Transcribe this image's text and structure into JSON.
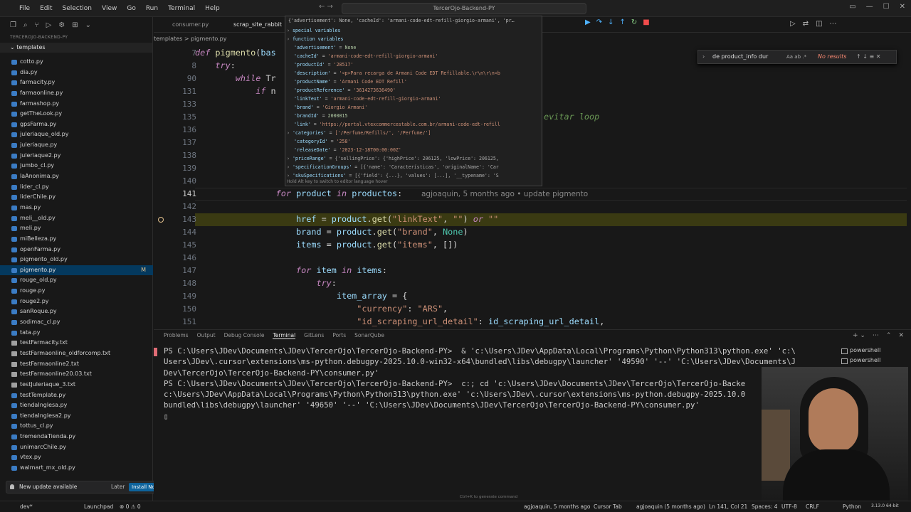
{
  "titlebar": {
    "menu": [
      "File",
      "Edit",
      "Selection",
      "View",
      "Go",
      "Run",
      "Terminal",
      "Help"
    ],
    "search": "TercerOjo-Backend-PY"
  },
  "sidebar": {
    "project": "TERCEROJO-BACKEND-PY",
    "folder": "templates",
    "files": [
      {
        "name": "cotto.py",
        "type": "py"
      },
      {
        "name": "dia.py",
        "type": "py"
      },
      {
        "name": "farmacity.py",
        "type": "py"
      },
      {
        "name": "farmaonline.py",
        "type": "py"
      },
      {
        "name": "farmashop.py",
        "type": "py"
      },
      {
        "name": "getTheLook.py",
        "type": "py"
      },
      {
        "name": "gpsFarma.py",
        "type": "py"
      },
      {
        "name": "juleriaque_old.py",
        "type": "py"
      },
      {
        "name": "juleriaque.py",
        "type": "py"
      },
      {
        "name": "juleriaque2.py",
        "type": "py"
      },
      {
        "name": "jumbo_cl.py",
        "type": "py"
      },
      {
        "name": "laAnonima.py",
        "type": "py"
      },
      {
        "name": "lider_cl.py",
        "type": "py"
      },
      {
        "name": "liderChile.py",
        "type": "py"
      },
      {
        "name": "mas.py",
        "type": "py"
      },
      {
        "name": "meli__old.py",
        "type": "py"
      },
      {
        "name": "meli.py",
        "type": "py"
      },
      {
        "name": "miBelleza.py",
        "type": "py"
      },
      {
        "name": "openFarma.py",
        "type": "py"
      },
      {
        "name": "pigmento_old.py",
        "type": "py"
      },
      {
        "name": "pigmento.py",
        "type": "py",
        "active": true,
        "mark": "M"
      },
      {
        "name": "rouge_old.py",
        "type": "py"
      },
      {
        "name": "rouge.py",
        "type": "py"
      },
      {
        "name": "rouge2.py",
        "type": "py"
      },
      {
        "name": "sanRoque.py",
        "type": "py"
      },
      {
        "name": "sodimac_cl.py",
        "type": "py"
      },
      {
        "name": "tata.py",
        "type": "py"
      },
      {
        "name": "testFarmacity.txt",
        "type": "txt"
      },
      {
        "name": "testFarmaonline_oldforcomp.txt",
        "type": "txt"
      },
      {
        "name": "testFarmaonline2.txt",
        "type": "txt"
      },
      {
        "name": "testFarmaonline20.03.txt",
        "type": "txt"
      },
      {
        "name": "testJuleriaque_3.txt",
        "type": "txt"
      },
      {
        "name": "testTemplate.py",
        "type": "py"
      },
      {
        "name": "tiendaInglesa.py",
        "type": "py"
      },
      {
        "name": "tiendaInglesa2.py",
        "type": "py"
      },
      {
        "name": "tottus_cl.py",
        "type": "py"
      },
      {
        "name": "tremendaTienda.py",
        "type": "py"
      },
      {
        "name": "unimarcChile.py",
        "type": "py"
      },
      {
        "name": "vtex.py",
        "type": "py"
      },
      {
        "name": "walmart_mx_old.py",
        "type": "py"
      }
    ],
    "toast": {
      "text": "New update available",
      "later": "Later",
      "install": "Install Now"
    }
  },
  "editor": {
    "tabs": [
      "consumer.py",
      "scrap_site_rabbit"
    ],
    "breadcrumb": "templates  >  pigmento.py",
    "lines": [
      {
        "n": "7",
        "html": "<span class='kw'>def</span> <span class='fn'>pigmento</span>(<span class='var'>bas</span>"
      },
      {
        "n": "8",
        "html": "    <span class='kw'>try</span>:"
      },
      {
        "n": "90",
        "html": "        <span class='kw'>while</span> Tr"
      },
      {
        "n": "131",
        "html": "            <span class='kw'>if</span> n"
      },
      {
        "n": "133",
        "html": ""
      },
      {
        "n": "135",
        "html": "                                                   <span class='cmt'>a, avanzamos para evitar loop</span>"
      },
      {
        "n": "136",
        "html": ""
      },
      {
        "n": "137",
        "html": ""
      },
      {
        "n": "138",
        "html": ""
      },
      {
        "n": "139",
        "html": ""
      },
      {
        "n": "140",
        "html": ""
      },
      {
        "n": "141",
        "html": "                <span class='kw'>for</span> <span class='var'>product</span> <span class='kw'>in</span> <span class='var'>productos</span>:"
      },
      {
        "n": "142",
        "html": ""
      },
      {
        "n": "143",
        "html": "                    <span class='var'>href</span> = <span class='var'>product</span>.<span class='fn'>get</span>(<span class='str'>\"linkText\"</span>, <span class='str'>\"\"</span>) <span class='kw'>or</span> <span class='str'>\"\"</span>"
      },
      {
        "n": "144",
        "html": "                    <span class='var'>brand</span> = <span class='var'>product</span>.<span class='fn'>get</span>(<span class='str'>\"brand\"</span>, <span class='cls'>None</span>)"
      },
      {
        "n": "145",
        "html": "                    <span class='var'>items</span> = <span class='var'>product</span>.<span class='fn'>get</span>(<span class='str'>\"items\"</span>, [])"
      },
      {
        "n": "146",
        "html": ""
      },
      {
        "n": "147",
        "html": "                    <span class='kw'>for</span> <span class='var'>item</span> <span class='kw'>in</span> <span class='var'>items</span>:"
      },
      {
        "n": "148",
        "html": "                        <span class='kw'>try</span>:"
      },
      {
        "n": "149",
        "html": "                            <span class='var'>item_array</span> = {"
      },
      {
        "n": "150",
        "html": "                                <span class='str'>\"currency\"</span>: <span class='str'>\"ARS\"</span>,"
      },
      {
        "n": "151",
        "html": "                                <span class='str'>\"id_scraping_url_detail\"</span>: <span class='var'>id_scraping_url_detail</span>,"
      }
    ],
    "blame": "agjoaquin, 5 months ago • update pigmento",
    "find": {
      "query": "de product_info dur",
      "opts": "Aa  ab  .*",
      "result": "No results"
    }
  },
  "hover": {
    "header": "{'advertisement': None, 'cacheId': 'armani-code-edt-refill-giorgio-armani', 'pr…",
    "rows": [
      {
        "tw": "›",
        "t": "special variables"
      },
      {
        "tw": "›",
        "t": "function variables"
      },
      {
        "k": "'advertisement'",
        "v": "None",
        "vt": "n"
      },
      {
        "k": "'cacheId'",
        "v": "'armani-code-edt-refill-giorgio-armani'",
        "vt": "s"
      },
      {
        "k": "'productId'",
        "v": "'28517'",
        "vt": "s"
      },
      {
        "k": "'description'",
        "v": "'<p>Para recarga de Armani Code EDT Refillable.\\r\\n\\r\\n<b",
        "vt": "s"
      },
      {
        "k": "'productName'",
        "v": "'Armani Code EDT Refill'",
        "vt": "s"
      },
      {
        "k": "'productReference'",
        "v": "'3614273636490'",
        "vt": "s"
      },
      {
        "k": "'linkText'",
        "v": "'armani-code-edt-refill-giorgio-armani'",
        "vt": "s"
      },
      {
        "k": "'brand'",
        "v": "'Giorgio Armani'",
        "vt": "s"
      },
      {
        "k": "'brandId'",
        "v": "2000015",
        "vt": "n"
      },
      {
        "k": "'link'",
        "v": "'https://portal.vtexcommercestable.com.br/armani-code-edt-refill",
        "vt": "s"
      },
      {
        "tw": "›",
        "k": "'categories'",
        "v": "['/Perfume/Refills/', '/Perfume/']",
        "vt": "s"
      },
      {
        "k": "'categoryId'",
        "v": "'258'",
        "vt": "s"
      },
      {
        "k": "'releaseDate'",
        "v": "'2023-12-18T00:00:00Z'",
        "vt": "s"
      },
      {
        "tw": "›",
        "k": "'priceRange'",
        "v": "{'sellingPrice': {'highPrice': 206125, 'lowPrice': 206125,",
        "vt": "p"
      },
      {
        "tw": "›",
        "k": "'specificationGroups'",
        "v": "[{'name': 'Características', 'originalName': 'Car",
        "vt": "p"
      },
      {
        "tw": "›",
        "k": "'skuSpecifications'",
        "v": "[{'field': {...}, 'values': [...], '__typename': 'S",
        "vt": "p"
      }
    ],
    "footer": "Hold Alt key to switch to editor language hover"
  },
  "panel": {
    "tabs": [
      "Problems",
      "Output",
      "Debug Console",
      "Terminal",
      "GitLens",
      "Ports",
      "SonarQube"
    ],
    "active_tab": "Terminal",
    "terminal_lines": [
      "PS C:\\Users\\JDev\\Documents\\JDev\\TercerOjo\\TercerOjo-Backend-PY>  & 'c:\\Users\\JDev\\AppData\\Local\\Programs\\Python\\Python313\\python.exe' 'c:\\",
      "Users\\JDev\\.cursor\\extensions\\ms-python.debugpy-2025.10.0-win32-x64\\bundled\\libs\\debugpy\\launcher' '49590' '--' 'C:\\Users\\JDev\\Documents\\J",
      "Dev\\TercerOjo\\TercerOjo-Backend-PY\\consumer.py'",
      "PS C:\\Users\\JDev\\Documents\\JDev\\TercerOjo\\TercerOjo-Backend-PY>  c:; cd 'c:\\Users\\JDev\\Documents\\JDev\\TercerOjo\\TercerOjo-Backe",
      "c:\\Users\\JDev\\AppData\\Local\\Programs\\Python\\Python313\\python.exe' 'c:\\Users\\JDev\\.cursor\\extensions\\ms-python.debugpy-2025.10.0",
      "bundled\\libs\\debugpy\\launcher' '49650' '--' 'C:\\Users\\JDev\\Documents\\JDev\\TercerOjo\\TercerOjo-Backend-PY\\consumer.py'",
      "▯"
    ],
    "terminal_list": [
      "powershell",
      "powershell"
    ]
  },
  "status": {
    "branch": "dev*",
    "launch": "Launchpad",
    "problems": "⊗ 0 ⚠ 0",
    "blame": "agjoaquin, 5 months ago",
    "cursor_tab": "Cursor Tab",
    "blame2": "agjoaquin (5 months ago)",
    "position": "Ln 141, Col 21",
    "spaces": "Spaces: 4",
    "encoding": "UTF-8",
    "eol": "CRLF",
    "lang": "Python",
    "version": "3.13.0 64-bit"
  },
  "hint": "Ctrl+K to generate command"
}
